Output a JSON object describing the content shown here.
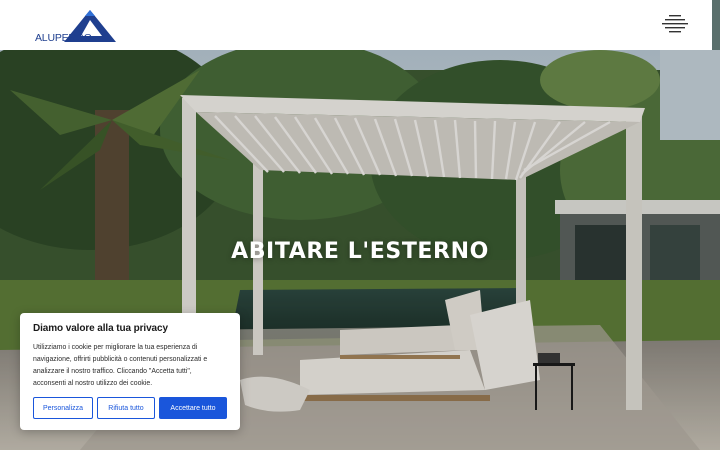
{
  "header": {
    "logo_text": "ALUPERGO",
    "menu_icon": "hamburger-menu-icon"
  },
  "hero": {
    "title": "ABITARE L'ESTERNO"
  },
  "cookie_banner": {
    "title": "Diamo valore alla tua privacy",
    "text_lines": [
      "Utilizziamo i cookie per migliorare la tua esperienza di",
      "navigazione, offrirti pubblicità o contenuti personalizzati e",
      "analizzare il nostro traffico. Cliccando \"Accetta tutti\",",
      "acconsenti al nostro utilizzo dei cookie."
    ],
    "btn_customize": "Personalizza",
    "btn_reject": "Rifiuta tutto",
    "btn_accept": "Accettare tutto"
  },
  "colors": {
    "brand_blue": "#1a56db",
    "logo_blue": "#1f3f8f"
  }
}
